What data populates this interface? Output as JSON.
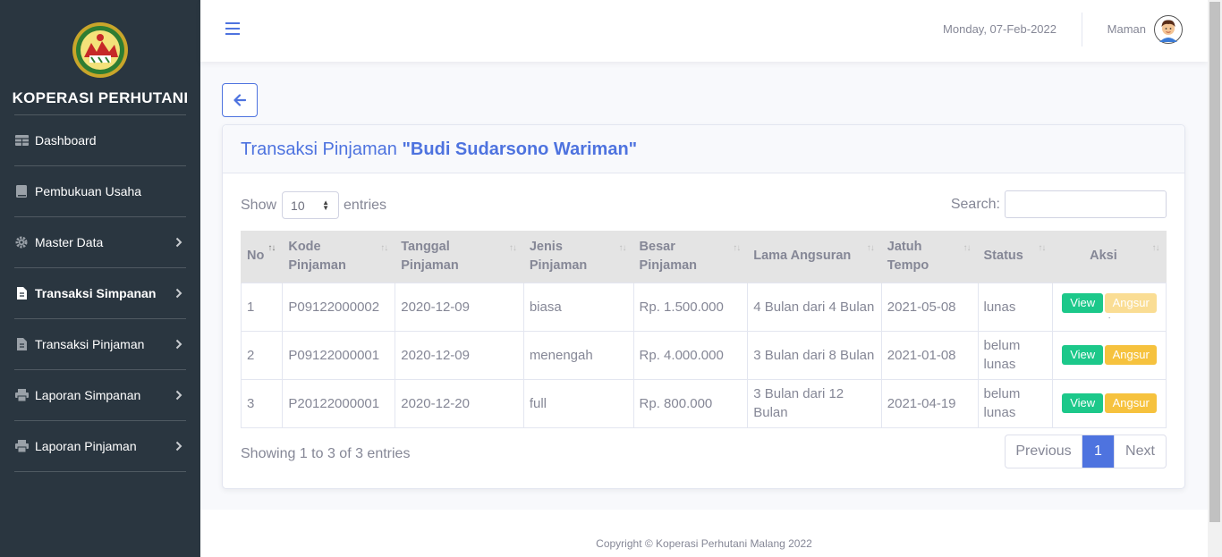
{
  "sidebar": {
    "brand": "KOPERASI PERHUTANI",
    "items": [
      {
        "label": "Dashboard",
        "icon": "table-icon"
      },
      {
        "label": "Pembukuan Usaha",
        "icon": "book-icon"
      },
      {
        "label": "Master Data",
        "icon": "gear-icon"
      },
      {
        "label": "Transaksi Simpanan",
        "icon": "file-icon"
      },
      {
        "label": "Transaksi Pinjaman",
        "icon": "file-icon"
      },
      {
        "label": "Laporan Simpanan",
        "icon": "print-icon"
      },
      {
        "label": "Laporan Pinjaman",
        "icon": "print-icon"
      }
    ]
  },
  "topbar": {
    "date": "Monday, 07-Feb-2022",
    "user": "Maman"
  },
  "card": {
    "title_prefix": "Transaksi Pinjaman",
    "title_name": "\"Budi Sudarsono Wariman\""
  },
  "table_controls": {
    "show_label": "Show",
    "entries_value": "10",
    "entries_label": "entries",
    "search_label": "Search:"
  },
  "table": {
    "headers": {
      "no": "No",
      "kode_pinjaman": "Kode Pinjaman",
      "tanggal_pinjaman": "Tanggal Pinjaman",
      "jenis_pinjaman": "Jenis Pinjaman",
      "besar_pinjaman": "Besar Pinjaman",
      "lama_angsuran": "Lama Angsuran",
      "jatuh_tempo": "Jatuh Tempo",
      "status": "Status",
      "aksi": "Aksi"
    },
    "rows": [
      {
        "no": "1",
        "kode": "P09122000002",
        "tanggal": "2020-12-09",
        "jenis": "biasa",
        "besar": "Rp. 1.500.000",
        "lama": "4 Bulan dari 4 Bulan",
        "jatuh": "2021-05-08",
        "status": "lunas",
        "view": "View",
        "angsur": "Angsur"
      },
      {
        "no": "2",
        "kode": "P09122000001",
        "tanggal": "2020-12-09",
        "jenis": "menengah",
        "besar": "Rp. 4.000.000",
        "lama": "3 Bulan dari 8 Bulan",
        "jatuh": "2021-01-08",
        "status": "belum lunas",
        "view": "View",
        "angsur": "Angsur"
      },
      {
        "no": "3",
        "kode": "P20122000001",
        "tanggal": "2020-12-20",
        "jenis": "full",
        "besar": "Rp. 800.000",
        "lama": "3 Bulan dari 12 Bulan",
        "jatuh": "2021-04-19",
        "status": "belum lunas",
        "view": "View",
        "angsur": "Angsur"
      }
    ]
  },
  "info": "Showing 1 to 3 of 3 entries",
  "pagination": {
    "previous": "Previous",
    "current": "1",
    "next": "Next"
  },
  "footer": "Copyright © Koperasi Perhutani Malang 2022",
  "colors": {
    "primary": "#4e73df",
    "success": "#1cc88a",
    "warning": "#f6c23e",
    "sidebar": "#2a3640"
  }
}
